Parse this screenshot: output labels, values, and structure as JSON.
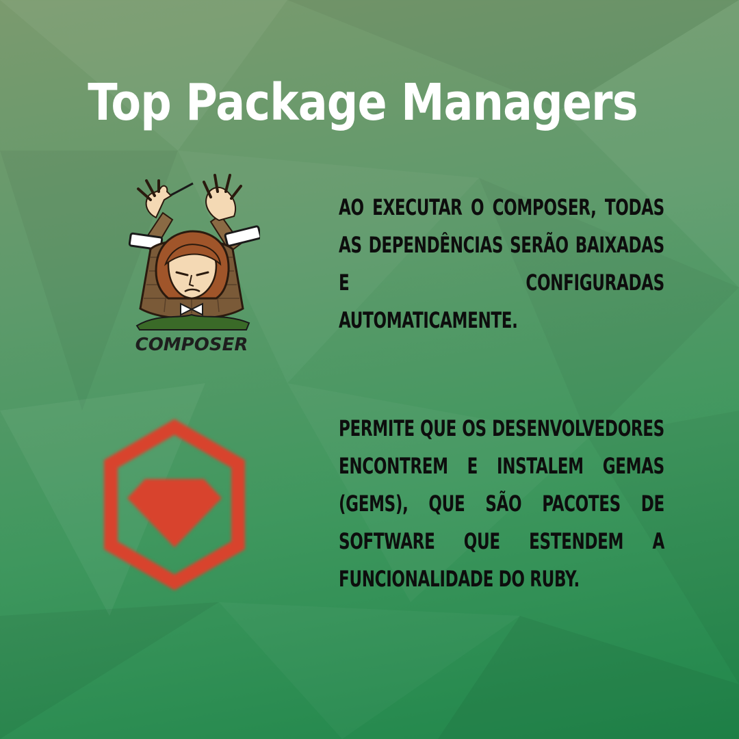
{
  "title": "Top Package Managers",
  "items": [
    {
      "logo_icon": "composer-logo-icon",
      "logo_text": "COMPOSER",
      "text": "AO EXECUTAR O COMPOSER, TODAS AS DEPENDÊNCIAS SERÃO BAIXADAS E CONFIGURADAS AUTOMATICAMENTE."
    },
    {
      "logo_icon": "rubygems-logo-icon",
      "text": "PERMITE QUE OS DESENVOLVEDORES ENCONTREM E INSTALEM GEMAS (GEMS), QUE SÃO PACOTES DE SOFTWARE QUE ESTENDEM A FUNCIONALIDADE DO RUBY."
    }
  ],
  "colors": {
    "title": "#ffffff",
    "body_text": "#0d0d0d",
    "rubygems_red": "#d8432d",
    "background_green": "#3f975e"
  }
}
